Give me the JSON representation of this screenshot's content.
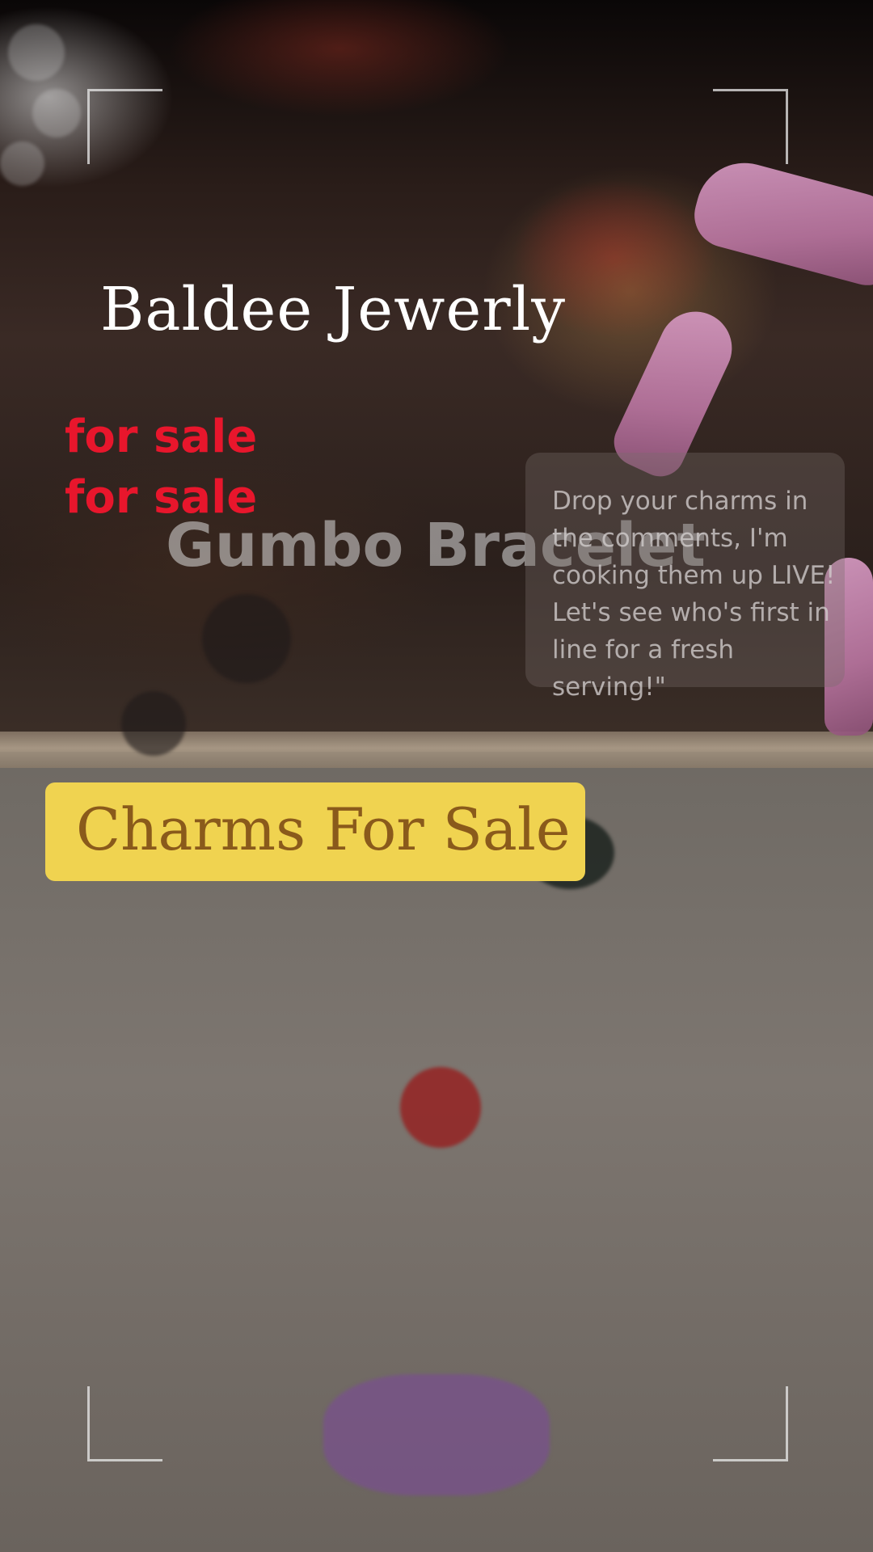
{
  "brand": {
    "name": "Baldee Jewerly"
  },
  "promo": {
    "line1": "for sale",
    "line2": "for sale"
  },
  "watermark_title": "Gumbo Bracelet",
  "live_caption": "Drop your charms in the comments, I'm cooking them up LIVE! Let's see who's first in line for a fresh serving!\"",
  "tag": {
    "label": "Charms For Sale"
  },
  "colors": {
    "promo_red": "#e8162c",
    "tag_yellow": "#f0d350",
    "tag_text_brown": "#8a5a1b",
    "brand_white": "#ffffff"
  }
}
